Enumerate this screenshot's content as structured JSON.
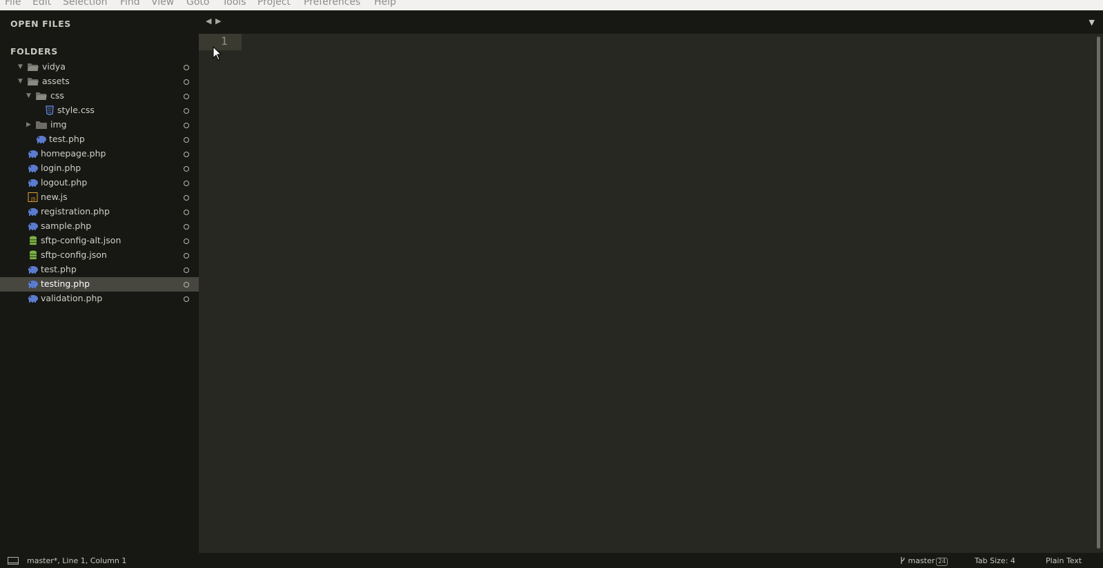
{
  "menu": [
    "File",
    "Edit",
    "Selection",
    "Find",
    "View",
    "Goto",
    "Tools",
    "Project",
    "Preferences",
    "Help"
  ],
  "sidebar": {
    "open_files_header": "OPEN FILES",
    "folders_header": "FOLDERS",
    "tree": [
      {
        "name": "vidya",
        "kind": "folder",
        "expanded": true,
        "icon": "folder-open-icon"
      },
      {
        "name": "assets",
        "kind": "folder",
        "expanded": true,
        "icon": "folder-open-icon"
      },
      {
        "name": "css",
        "kind": "folder",
        "expanded": true,
        "icon": "folder-open-icon"
      },
      {
        "name": "style.css",
        "kind": "file",
        "icon": "css-file-icon"
      },
      {
        "name": "img",
        "kind": "folder",
        "expanded": false,
        "icon": "folder-icon"
      },
      {
        "name": "test.php",
        "kind": "file",
        "icon": "php-file-icon"
      },
      {
        "name": "homepage.php",
        "kind": "file",
        "icon": "php-file-icon"
      },
      {
        "name": "login.php",
        "kind": "file",
        "icon": "php-file-icon"
      },
      {
        "name": "logout.php",
        "kind": "file",
        "icon": "php-file-icon"
      },
      {
        "name": "new.js",
        "kind": "file",
        "icon": "js-file-icon"
      },
      {
        "name": "registration.php",
        "kind": "file",
        "icon": "php-file-icon"
      },
      {
        "name": "sample.php",
        "kind": "file",
        "icon": "php-file-icon"
      },
      {
        "name": "sftp-config-alt.json",
        "kind": "file",
        "icon": "json-file-icon"
      },
      {
        "name": "sftp-config.json",
        "kind": "file",
        "icon": "json-file-icon"
      },
      {
        "name": "test.php",
        "kind": "file",
        "icon": "php-file-icon"
      },
      {
        "name": "testing.php",
        "kind": "file",
        "icon": "php-file-icon",
        "selected": true
      },
      {
        "name": "validation.php",
        "kind": "file",
        "icon": "php-file-icon"
      }
    ]
  },
  "editor": {
    "line_numbers": [
      "1"
    ]
  },
  "statusbar": {
    "position": "master*, Line 1, Column 1",
    "branch": "master",
    "branch_count": "24",
    "tab_size": "Tab Size: 4",
    "syntax": "Plain Text"
  },
  "colors": {
    "sidebar_bg": "#171814",
    "editor_bg": "#272822",
    "selection_bg": "#47463f",
    "php_icon": "#5b7bcf",
    "json_icon": "#7cb342",
    "js_icon": "#e0a030"
  }
}
